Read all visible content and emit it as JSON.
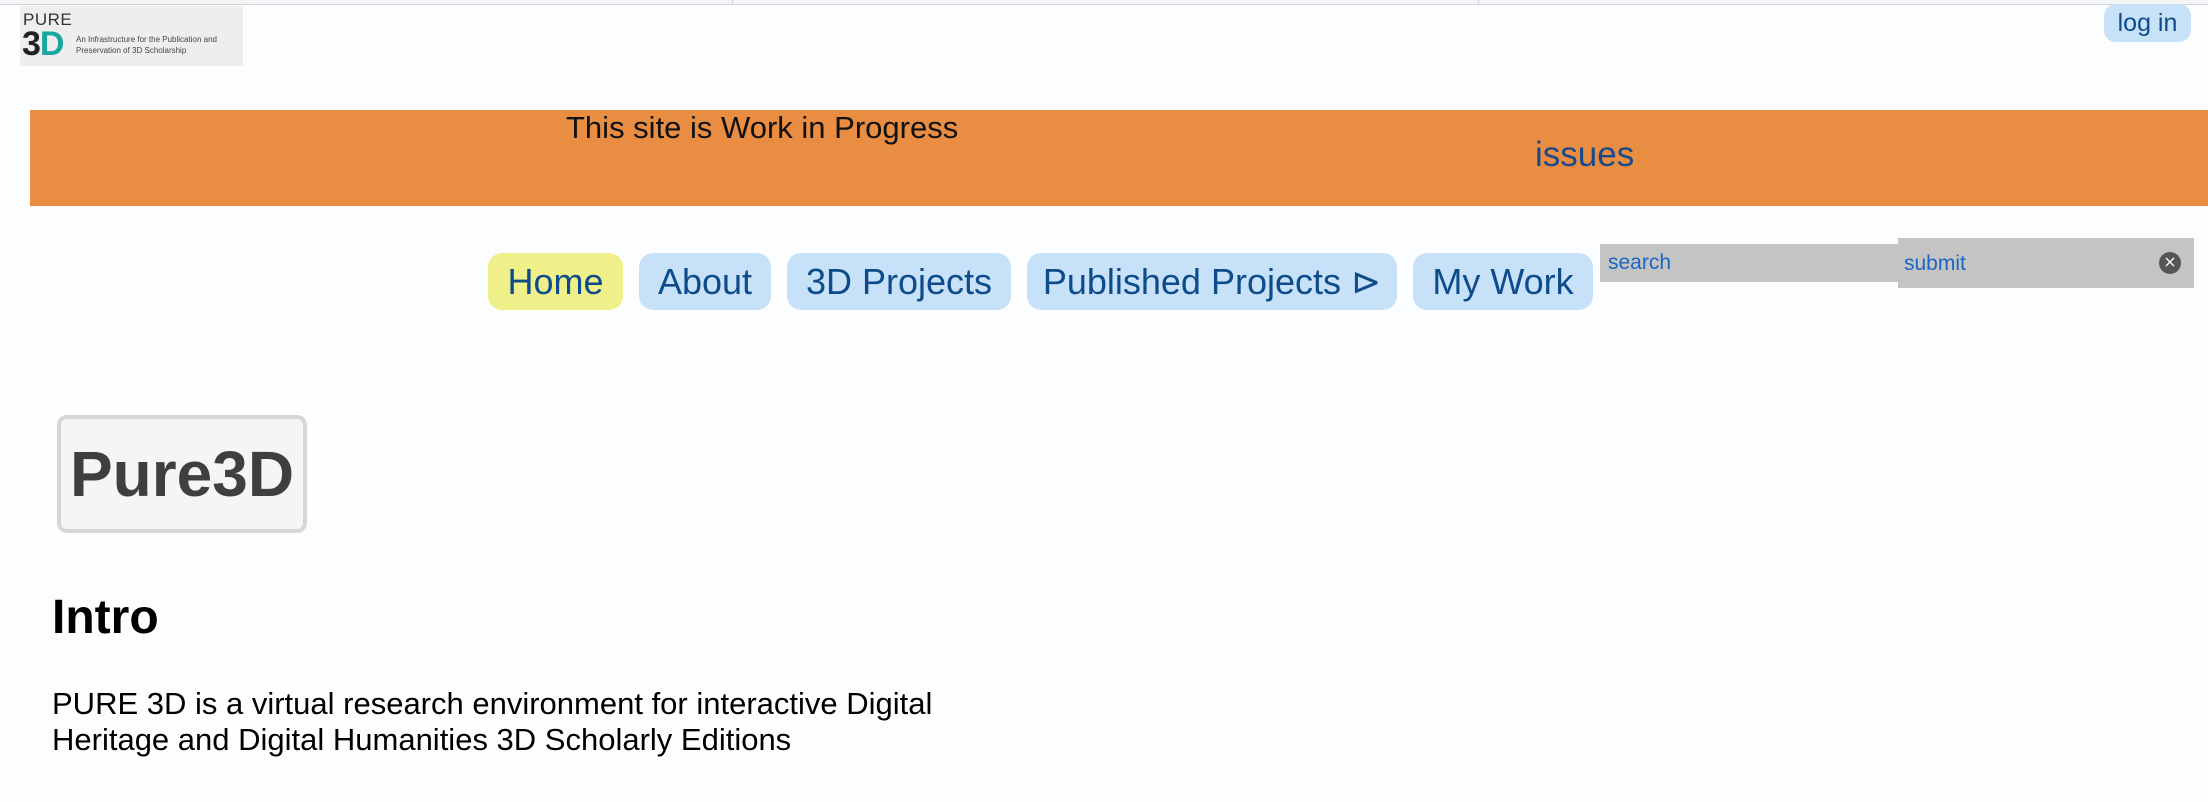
{
  "logo": {
    "top_text": "PURE",
    "mark_three": "3",
    "mark_d": "D",
    "tagline": "An Infrastructure for the Publication and Preservation of 3D Scholarship"
  },
  "header": {
    "login_label": "log in"
  },
  "banner": {
    "notice": "This site is Work in Progress",
    "issues_link": "issues",
    "color": "#e88d42"
  },
  "nav": {
    "items": [
      {
        "label": "Home",
        "active": true
      },
      {
        "label": "About"
      },
      {
        "label": "3D Projects"
      },
      {
        "label": "Published Projects ⊳"
      },
      {
        "label": "My Work"
      }
    ],
    "active_color": "#f0f08a",
    "item_color": "#c7e2f8"
  },
  "search": {
    "placeholder": "search",
    "submit_label": "submit",
    "clear_icon": "⨯"
  },
  "main": {
    "site_title": "Pure3D",
    "intro_heading": "Intro",
    "intro_text": "PURE 3D is a virtual research environment for interactive Digital Heritage and Digital Humanities 3D Scholarly Editions"
  }
}
